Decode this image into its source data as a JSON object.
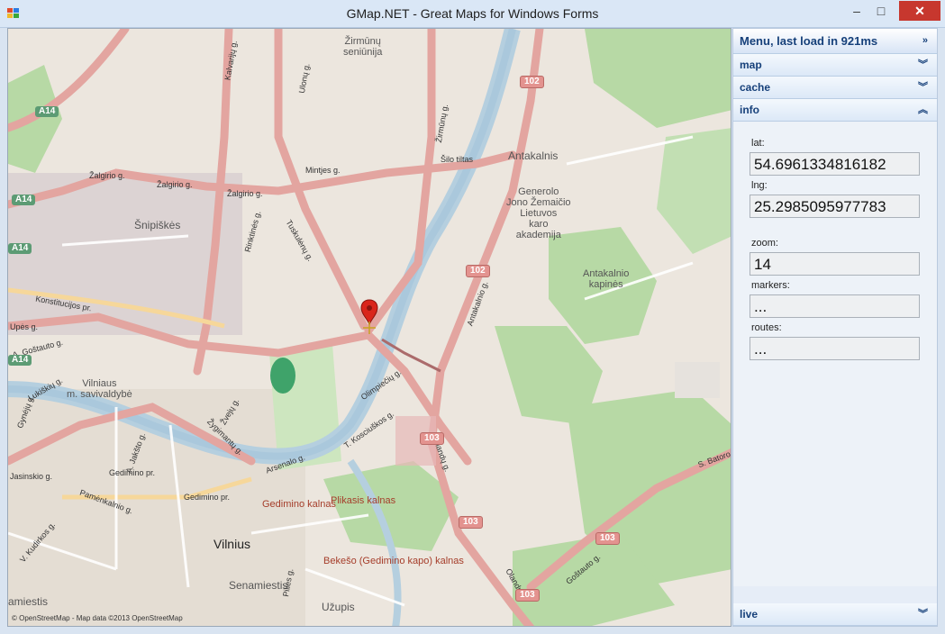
{
  "window": {
    "title": "GMap.NET - Great Maps for Windows Forms",
    "minimize": "–",
    "maximize": "□",
    "close": "✕"
  },
  "map": {
    "labels": {
      "zirmunu_seniunija": "Žirmūnų\nseniūnija",
      "antakalnis": "Antakalnis",
      "generolo": "Generolo\nJono Žemaičio\nLietuvos\nkaro\nakademija",
      "snipiskes": "Šnipiškės",
      "antakalnio_kapines": "Antakalnio\nkapinės",
      "vilniaus_savivaldybe": "Vilniaus\nm. savivaldybė",
      "vilnius": "Vilnius",
      "senamiestis": "Senamiestis",
      "uzupis": "Užupis",
      "gedimino_kalnas": "Gedimino kalnas",
      "plikasis_kalnas": "Plikasis kalnas",
      "bekeso": "Bekešo (Gedimino kapo) kalnas",
      "saltiniai": "amiestis"
    },
    "roads": {
      "mintjes": "Mintjes g.",
      "zalgirio1": "Žalgirio g.",
      "zalgirio2": "Žalgirio g.",
      "zalgirio3": "Žalgirio g.",
      "silo_tiltas": "Šilo tiltas",
      "kalvariju": "Kalvarijų g.",
      "ulonu": "Ulonų g.",
      "zirmunu": "Žirmūnų g.",
      "antakalnio": "Antakalnio g.",
      "konstitucijos": "Konstitucijos pr.",
      "upes": "Upės g.",
      "olimpieciu": "Olimpiečių g.",
      "kosciuskos": "T. Kosciuškos g.",
      "arsenalo": "Arsenalo g.",
      "gedimino_pr1": "Gedimino pr.",
      "gedimino_pr2": "Gedimino pr.",
      "olandu": "Olandų g.",
      "sbatoro": "S. Batoro",
      "lukiskiu": "Lukiškių g.",
      "zveju": "Žvejų g.",
      "zygimantu": "Žygimantų g.",
      "ajakstos": "A. Jakšto g.",
      "vkudirkos": "V. Kudirkos g.",
      "jasinskio": "Jasinskio g.",
      "pamenkalnio": "Pamėnkalnio g.",
      "gostauto": "A. Goštauto g.",
      "pilies": "Pilies g.",
      "gyneju": "Gynėjų g.",
      "rinktines": "Rinktinės g.",
      "tuskulenu": "Tuskulėnų g.",
      "olandug2": "Olandų g.",
      "sgostauto": "Goštauto g."
    },
    "badges": {
      "a14_1": "A14",
      "a14_2": "A14",
      "a14_3": "A14",
      "a14_4": "A14",
      "r102_1": "102",
      "r102_2": "102",
      "r103_1": "103",
      "r103_2": "103",
      "r103_3": "103",
      "r103_4": "103"
    },
    "copyright": "© OpenStreetMap - Map data ©2013 OpenStreetMap"
  },
  "panel": {
    "header": "Menu, last load in 921ms",
    "sections": {
      "map": "map",
      "cache": "cache",
      "info": "info",
      "live": "live"
    },
    "info": {
      "lat_label": "lat:",
      "lat_value": "54.6961334816182",
      "lng_label": "lng:",
      "lng_value": "25.2985095977783",
      "zoom_label": "zoom:",
      "zoom_value": "14",
      "markers_label": "markers:",
      "markers_value": "...",
      "routes_label": "routes:",
      "routes_value": "..."
    }
  }
}
